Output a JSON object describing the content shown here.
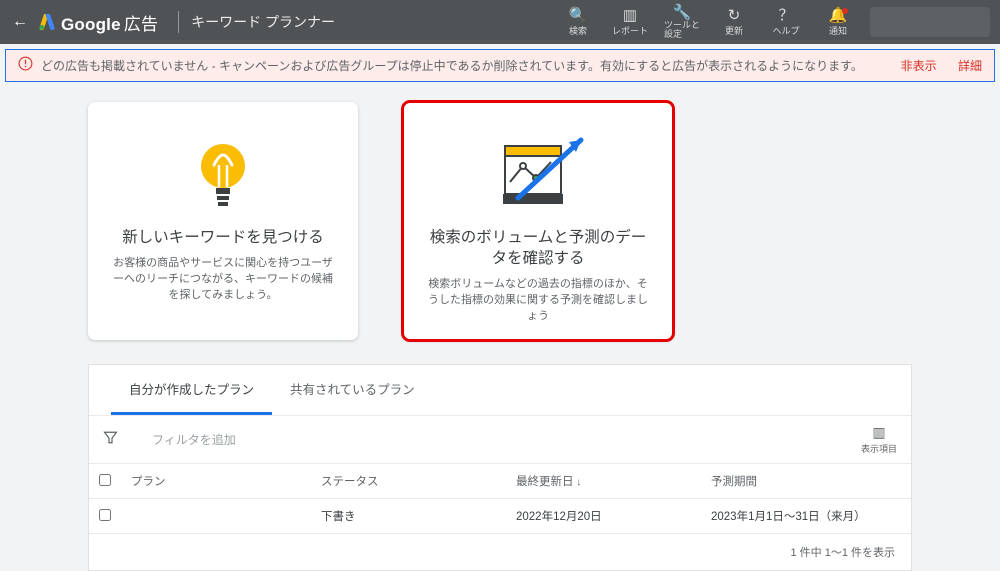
{
  "header": {
    "brand_main": "Google",
    "brand_sub": "広告",
    "page_title": "キーワード プランナー",
    "tools": {
      "search": "検索",
      "reports": "レポート",
      "tools": "ツールと\n設定",
      "refresh": "更新",
      "help": "ヘルプ",
      "notif": "通知"
    }
  },
  "alert": {
    "message": "どの広告も掲載されていません - キャンペーンおよび広告グループは停止中であるか削除されています。有効にすると広告が表示されるようになります。",
    "hide": "非表示",
    "details": "詳細"
  },
  "cards": {
    "discover": {
      "title": "新しいキーワードを見つける",
      "desc": "お客様の商品やサービスに関心を持つユーザーへのリーチにつながる、キーワードの候補を探してみましょう。"
    },
    "forecast": {
      "title": "検索のボリュームと予測のデータを確認する",
      "desc": "検索ボリュームなどの過去の指標のほか、そうした指標の効果に関する予測を確認しましょう"
    }
  },
  "tabs": {
    "mine": "自分が作成したプラン",
    "shared": "共有されているプラン"
  },
  "filter": {
    "hint": "フィルタを追加",
    "cols": "表示項目"
  },
  "table": {
    "headers": {
      "plan": "プラン",
      "status": "ステータス",
      "updated": "最終更新日",
      "period": "予測期間"
    },
    "rows": [
      {
        "plan": "",
        "status": "下書き",
        "updated": "2022年12月20日",
        "period": "2023年1月1日～31日（来月）"
      }
    ]
  },
  "pager": "1 件中 1～1 件を表示"
}
